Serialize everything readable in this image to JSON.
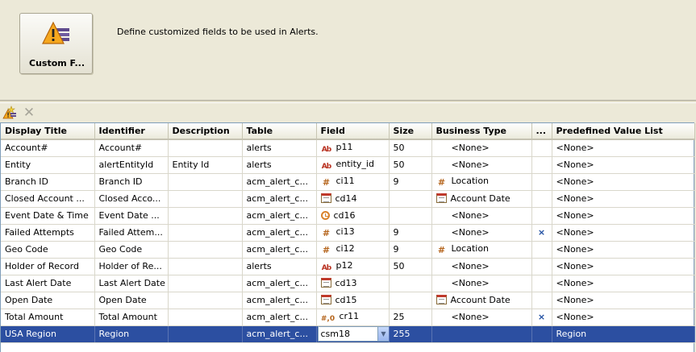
{
  "top_panel": {
    "tile_label": "Custom F...",
    "description": "Define customized fields to be used in Alerts."
  },
  "toolbar": {
    "add_icon": "add-field-icon",
    "delete_icon": "delete-icon",
    "delete_glyph": "✕"
  },
  "table": {
    "headers": [
      "Display Title",
      "Identifier",
      "Description",
      "Table",
      "Field",
      "Size",
      "Business Type",
      "...",
      "Predefined Value List"
    ],
    "rows": [
      {
        "title": "Account#",
        "identifier": "Account#",
        "description": "",
        "table": "alerts",
        "field_icon": "text",
        "field": "p11",
        "size": "50",
        "biz_icon": "",
        "business_type": "<None>",
        "flag": "",
        "predefined": "<None>"
      },
      {
        "title": "Entity",
        "identifier": "alertEntityId",
        "description": "Entity Id",
        "table": "alerts",
        "field_icon": "text",
        "field": "entity_id",
        "size": "50",
        "biz_icon": "",
        "business_type": "<None>",
        "flag": "",
        "predefined": "<None>"
      },
      {
        "title": "Branch ID",
        "identifier": "Branch ID",
        "description": "",
        "table": "acm_alert_c...",
        "field_icon": "number",
        "field": "ci11",
        "size": "9",
        "biz_icon": "number",
        "business_type": "Location",
        "flag": "",
        "predefined": "<None>"
      },
      {
        "title": "Closed Account ...",
        "identifier": "Closed Acco...",
        "description": "",
        "table": "acm_alert_c...",
        "field_icon": "date",
        "field": "cd14",
        "size": "",
        "biz_icon": "date",
        "business_type": "Account Date",
        "flag": "",
        "predefined": "<None>"
      },
      {
        "title": "Event Date & Time",
        "identifier": "Event Date ...",
        "description": "",
        "table": "acm_alert_c...",
        "field_icon": "time",
        "field": "cd16",
        "size": "",
        "biz_icon": "",
        "business_type": "<None>",
        "flag": "",
        "predefined": "<None>"
      },
      {
        "title": "Failed Attempts",
        "identifier": "Failed Attem...",
        "description": "",
        "table": "acm_alert_c...",
        "field_icon": "number",
        "field": "ci13",
        "size": "9",
        "biz_icon": "",
        "business_type": "<None>",
        "flag": "×",
        "predefined": "<None>"
      },
      {
        "title": "Geo Code",
        "identifier": "Geo Code",
        "description": "",
        "table": "acm_alert_c...",
        "field_icon": "number",
        "field": "ci12",
        "size": "9",
        "biz_icon": "number",
        "business_type": "Location",
        "flag": "",
        "predefined": "<None>"
      },
      {
        "title": "Holder of Record",
        "identifier": "Holder of Re...",
        "description": "",
        "table": "alerts",
        "field_icon": "text",
        "field": "p12",
        "size": "50",
        "biz_icon": "",
        "business_type": "<None>",
        "flag": "",
        "predefined": "<None>"
      },
      {
        "title": "Last Alert Date",
        "identifier": "Last Alert Date",
        "description": "",
        "table": "acm_alert_c...",
        "field_icon": "date",
        "field": "cd13",
        "size": "",
        "biz_icon": "",
        "business_type": "<None>",
        "flag": "",
        "predefined": "<None>"
      },
      {
        "title": "Open Date",
        "identifier": "Open Date",
        "description": "",
        "table": "acm_alert_c...",
        "field_icon": "date",
        "field": "cd15",
        "size": "",
        "biz_icon": "date",
        "business_type": "Account Date",
        "flag": "",
        "predefined": "<None>"
      },
      {
        "title": "Total Amount",
        "identifier": "Total Amount",
        "description": "",
        "table": "acm_alert_c...",
        "field_icon": "currency",
        "field": "cr11",
        "size": "25",
        "biz_icon": "",
        "business_type": "<None>",
        "flag": "×",
        "predefined": "<None>"
      },
      {
        "title": "USA Region",
        "identifier": "Region",
        "description": "",
        "table": "acm_alert_c...",
        "field_icon": "",
        "field": "csm18",
        "size": "255",
        "biz_icon": "",
        "business_type": "",
        "flag": "",
        "predefined": "Region"
      }
    ],
    "selected_row": 11,
    "icon_glyphs": {
      "text": "Ab",
      "number": "#",
      "currency": "#,0"
    }
  },
  "colors": {
    "selection": "#2c4fa1",
    "window_bg": "#ece9d8",
    "flag_blue": "#1f4ea1"
  }
}
